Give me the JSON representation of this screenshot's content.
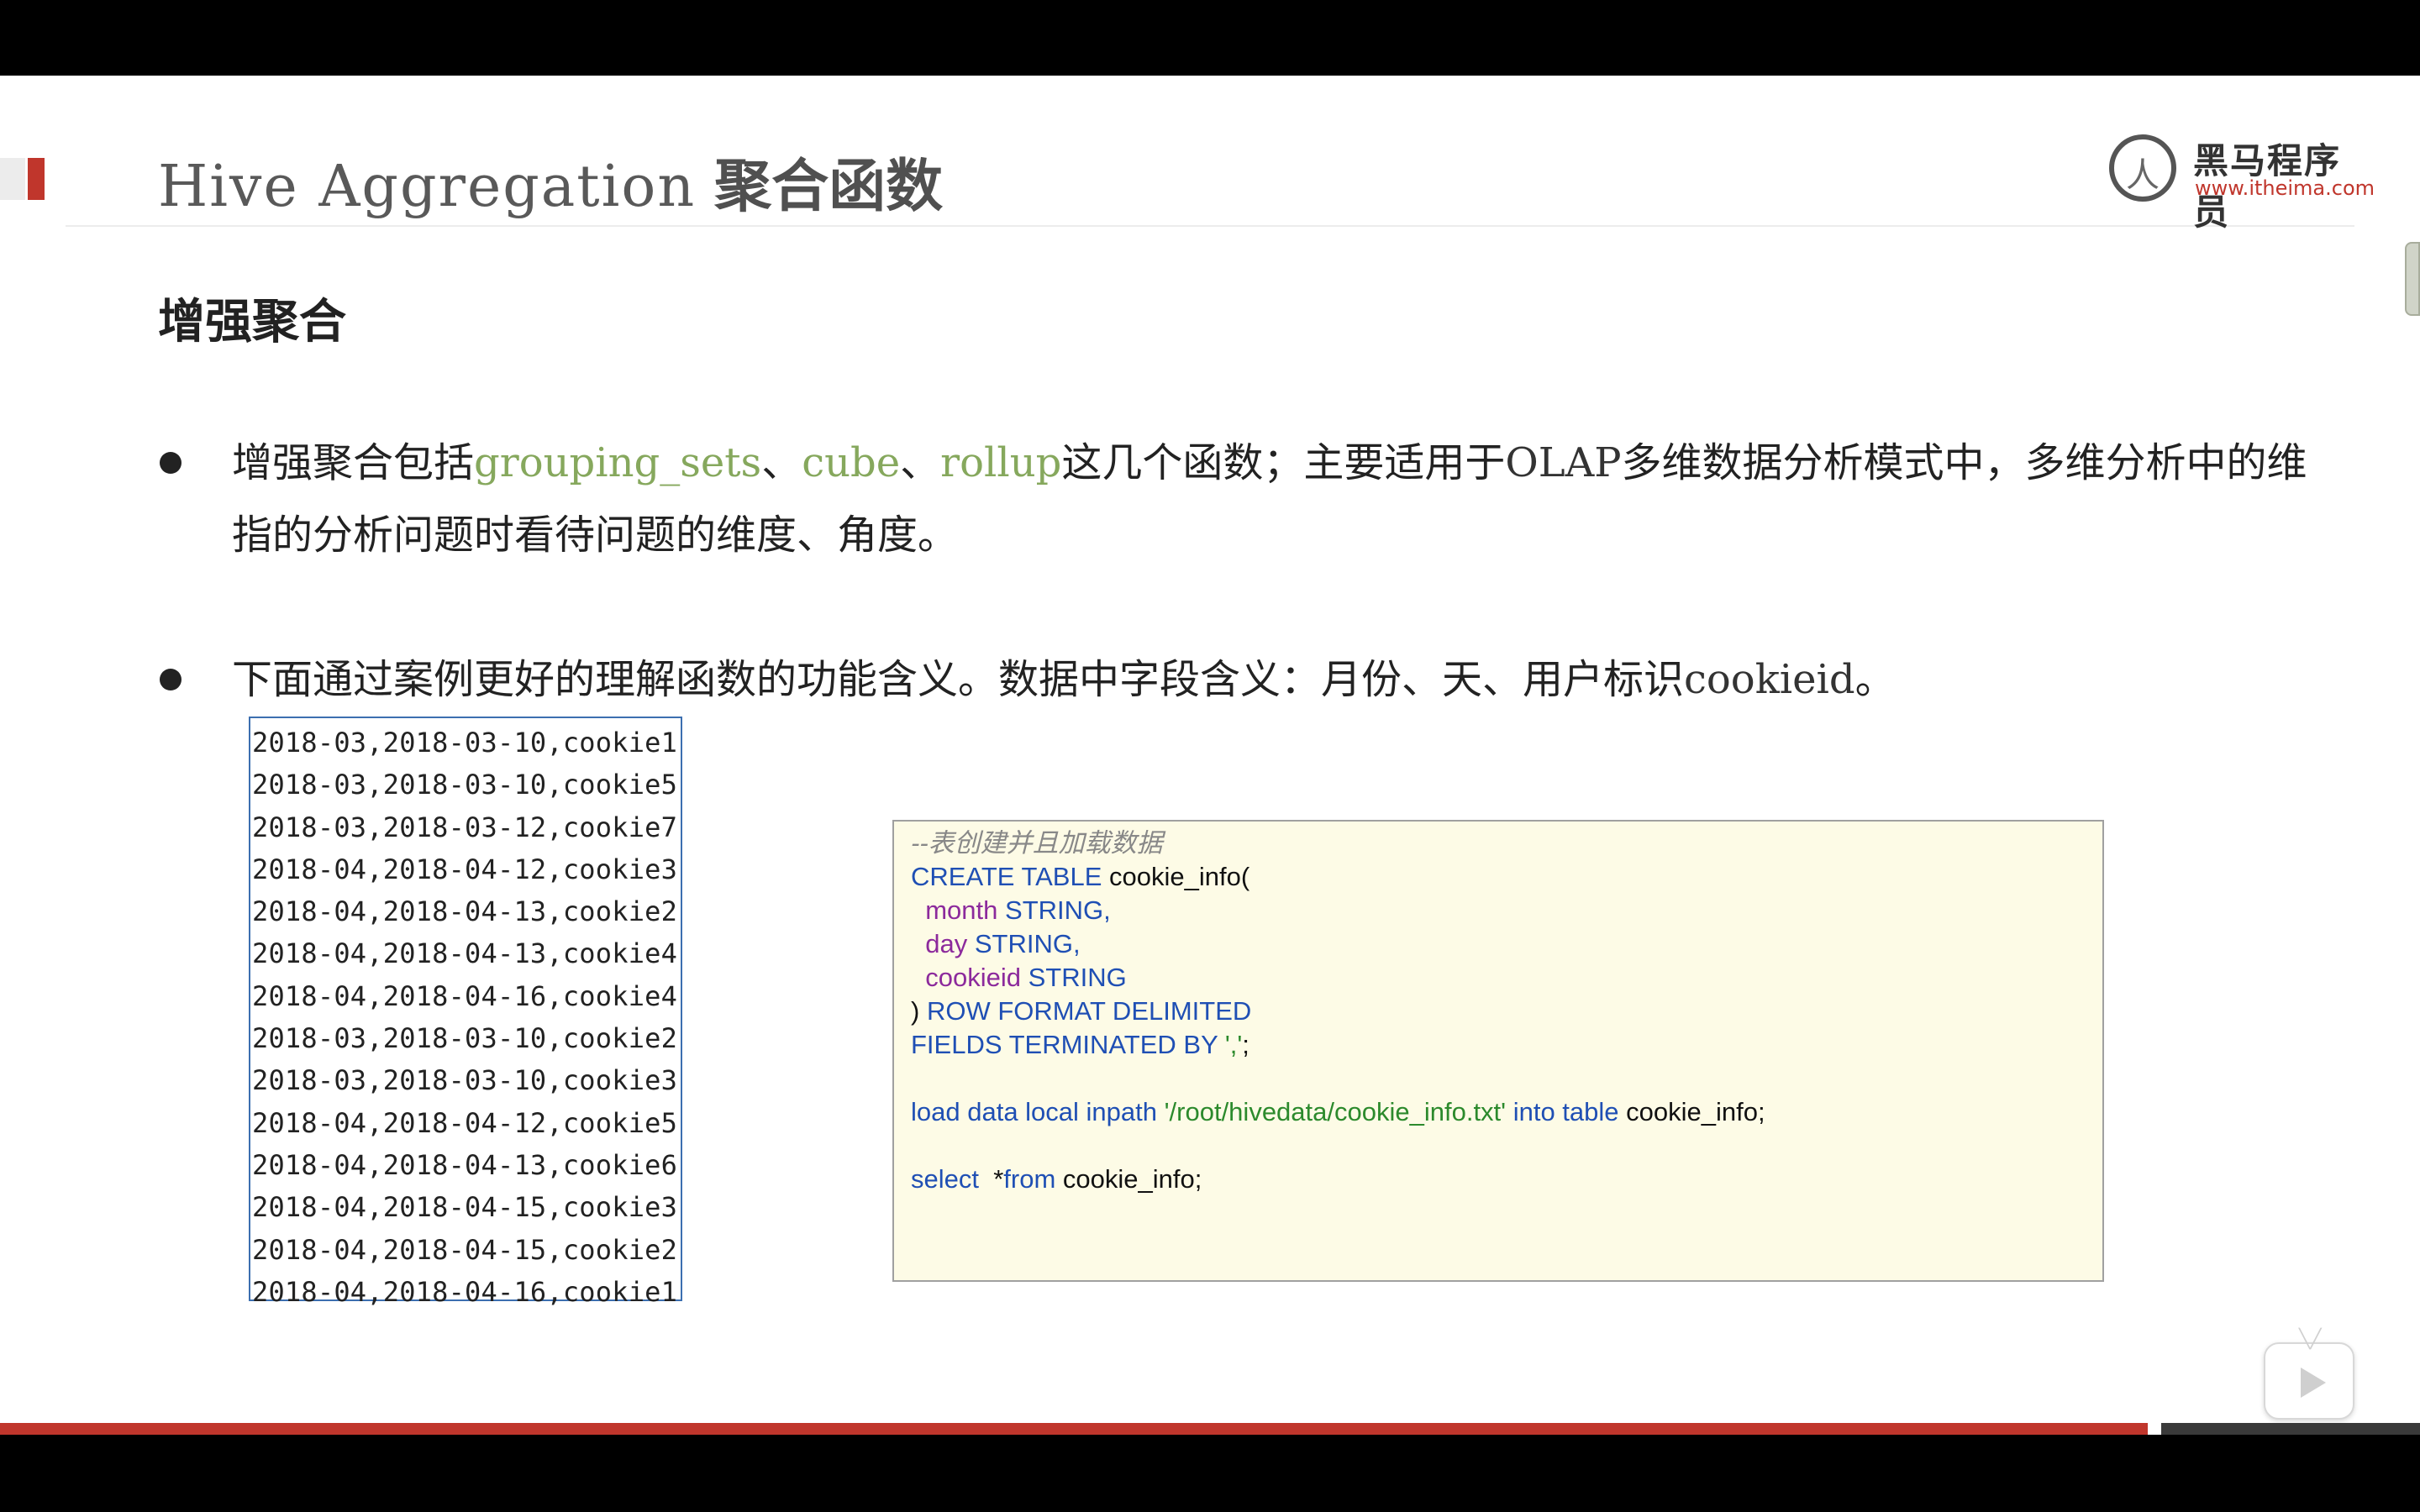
{
  "slide": {
    "title_en": "Hive Aggregation",
    "title_cn": "聚合函数",
    "logo": {
      "name": "黑马程序员",
      "url": "www.itheima.com",
      "glyph": "人"
    },
    "section_heading": "增强聚合",
    "bullets": [
      {
        "line1_pre": "增强聚合包括",
        "fn1": "grouping_sets",
        "sep1": "、",
        "fn2": "cube",
        "sep2": "、",
        "fn3": "rollup",
        "line1_mid": "这几个函数；主要适用于",
        "olap": "OLAP",
        "line1_post": "多维数据分析模式中，多维分析中的维",
        "line2": "指的分析问题时看待问题的维度、角度。"
      },
      {
        "pre": "下面通过案例更好的理解函数的功能含义。数据中字段含义：月份、天、用户标识",
        "field": "cookieid",
        "post": "。"
      }
    ],
    "data_rows": [
      "2018-03,2018-03-10,cookie1",
      "2018-03,2018-03-10,cookie5",
      "2018-03,2018-03-12,cookie7",
      "2018-04,2018-04-12,cookie3",
      "2018-04,2018-04-13,cookie2",
      "2018-04,2018-04-13,cookie4",
      "2018-04,2018-04-16,cookie4",
      "2018-03,2018-03-10,cookie2",
      "2018-03,2018-03-10,cookie3",
      "2018-04,2018-04-12,cookie5",
      "2018-04,2018-04-13,cookie6",
      "2018-04,2018-04-15,cookie3",
      "2018-04,2018-04-15,cookie2",
      "2018-04,2018-04-16,cookie1"
    ],
    "sql": {
      "comment": "--表创建并且加载数据",
      "create_kw": "CREATE TABLE",
      "create_rest": " cookie_info(",
      "col1": "month",
      "col1_type": " STRING,",
      "col2": "day",
      "col2_type": " STRING,",
      "col3": "cookieid",
      "col3_type": " STRING",
      "close_paren": ")",
      "row_format": " ROW FORMAT DELIMITED",
      "fields": "FIELDS TERMINATED BY ",
      "delim": "','",
      "semi": ";",
      "load_kw": "load data local inpath ",
      "load_path": "'/root/hivedata/cookie_info.txt'",
      "into_kw": " into table",
      "load_rest": " cookie_info;",
      "select_kw": "select",
      "star": "  *",
      "from_kw": "from",
      "select_rest": " cookie_info;"
    }
  },
  "colors": {
    "accent_red": "#c0362c",
    "keyword_blue": "#1f4fb4",
    "column_purple": "#8c2a9c",
    "string_green": "#2c8a2c",
    "function_green": "#86a85d"
  }
}
